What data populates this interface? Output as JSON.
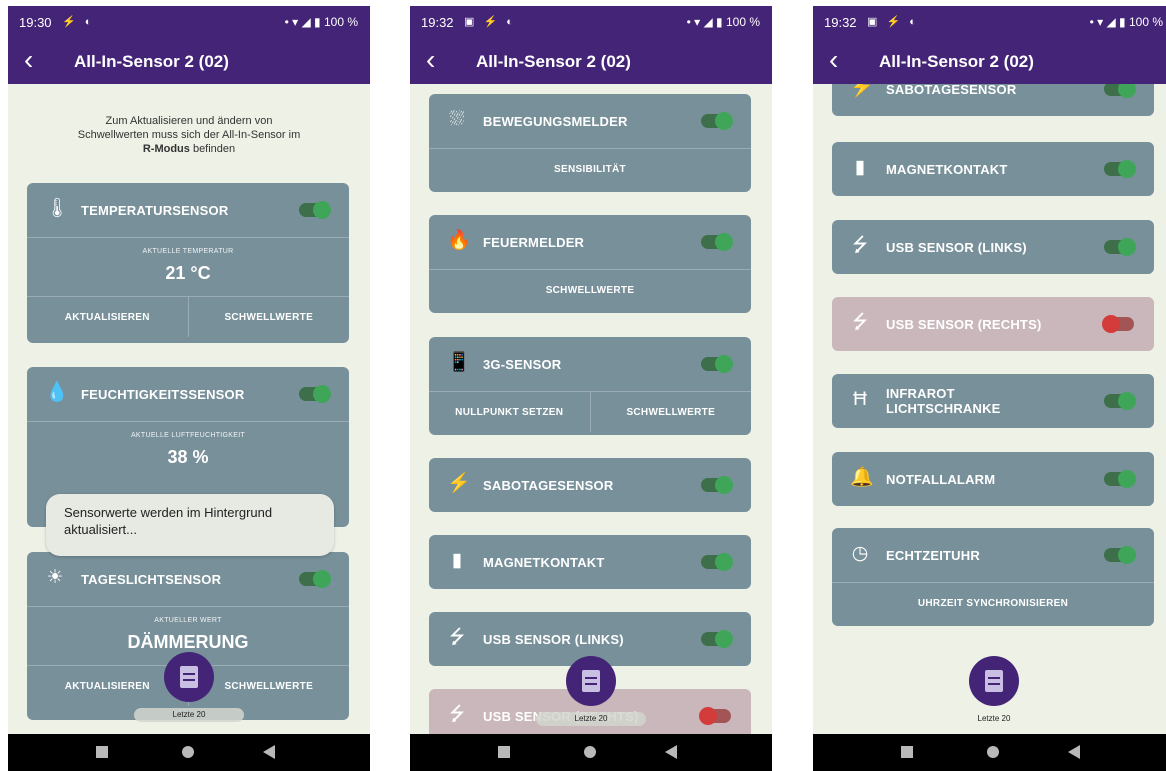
{
  "app": {
    "title": "All-In-Sensor 2 (02)",
    "back_glyph": "‹"
  },
  "colors": {
    "header": "#442477",
    "card": "#78909a",
    "card_off": "#c9b7bb",
    "toggle_on": "#3fa659",
    "toggle_off": "#d43b3b"
  },
  "screens": [
    {
      "status": {
        "time": "19:30",
        "icons": "⚡ ◐",
        "right": "• ▾ ◢ ▮ 100 %"
      },
      "note": {
        "line1": "Zum Aktualisieren und ändern von",
        "line2": "Schwellwerten muss sich der All-In-Sensor im",
        "bold": "R-Modus",
        "tail": " befinden"
      },
      "cards": [
        {
          "name": "TEMPERATURSENSOR",
          "icon": "thermometer-icon",
          "glyph": "🌡",
          "reading_label": "AKTUELLE TEMPERATUR",
          "reading_value": "21 °C",
          "action1": "AKTUALISIEREN",
          "action2": "SCHWELLWERTE",
          "on": true
        },
        {
          "name": "FEUCHTIGKEITSSENSOR",
          "icon": "droplet-icon",
          "glyph": "💧",
          "reading_label": "AKTUELLE LUFTFEUCHTIGKEIT",
          "reading_value": "38 %",
          "on": true
        },
        {
          "name": "TAGESLICHTSENSOR",
          "icon": "daylight-icon",
          "glyph": "☀",
          "reading_label": "AKTUELLER WERT",
          "reading_value": "DÄMMERUNG",
          "action1": "AKTUALISIEREN",
          "action2": "SCHWELLWERTE",
          "on": true
        }
      ],
      "toast": "Sensorwerte werden im Hintergrund aktualisiert...",
      "fab_label": "Letzte 20"
    },
    {
      "status": {
        "time": "19:32",
        "icons": "▣ ⚡ ◐",
        "right": "• ▾ ◢ ▮ 100 %"
      },
      "cards": [
        {
          "name": "BEWEGUNGSMELDER",
          "icon": "motion-icon",
          "glyph": "⛆",
          "action": "SENSIBILITÄT",
          "on": true
        },
        {
          "name": "FEUERMELDER",
          "icon": "fire-icon",
          "glyph": "🔥",
          "action": "SCHWELLWERTE",
          "on": true
        },
        {
          "name": "3G-SENSOR",
          "icon": "rotation-icon",
          "glyph": "📱",
          "action1": "NULLPUNKT SETZEN",
          "action2": "SCHWELLWERTE",
          "on": true
        },
        {
          "name": "SABOTAGESENSOR",
          "icon": "tamper-icon",
          "glyph": "⚡",
          "on": true
        },
        {
          "name": "MAGNETKONTAKT",
          "icon": "magnet-icon",
          "glyph": "▮",
          "on": true
        },
        {
          "name": "USB SENSOR (LINKS)",
          "icon": "usb-icon",
          "glyph": "⭍",
          "on": true
        },
        {
          "name": "USB SENSOR (RECHTS)",
          "icon": "usb-icon",
          "glyph": "⭍",
          "on": false
        }
      ],
      "fab_label": "Letzte 20"
    },
    {
      "status": {
        "time": "19:32",
        "icons": "▣ ⚡ ◐",
        "right": "• ▾ ◢ ▮ 100 %"
      },
      "cards": [
        {
          "name": "SABOTAGESENSOR",
          "icon": "tamper-icon",
          "glyph": "⚡",
          "on": true
        },
        {
          "name": "MAGNETKONTAKT",
          "icon": "magnet-icon",
          "glyph": "▮",
          "on": true
        },
        {
          "name": "USB SENSOR (LINKS)",
          "icon": "usb-icon",
          "glyph": "⭍",
          "on": true
        },
        {
          "name": "USB SENSOR (RECHTS)",
          "icon": "usb-icon",
          "glyph": "⭍",
          "on": false
        },
        {
          "name_line1": "INFRAROT",
          "name_line2": "LICHTSCHRANKE",
          "icon": "light-barrier-icon",
          "glyph": "Ħ",
          "on": true
        },
        {
          "name": "NOTFALLALARM",
          "icon": "bell-icon",
          "glyph": "🔔",
          "on": true
        },
        {
          "name": "ECHTZEITUHR",
          "icon": "clock-icon",
          "glyph": "◷",
          "action": "UHRZEIT SYNCHRONISIEREN",
          "on": true
        }
      ],
      "fab_label": "Letzte 20"
    }
  ]
}
